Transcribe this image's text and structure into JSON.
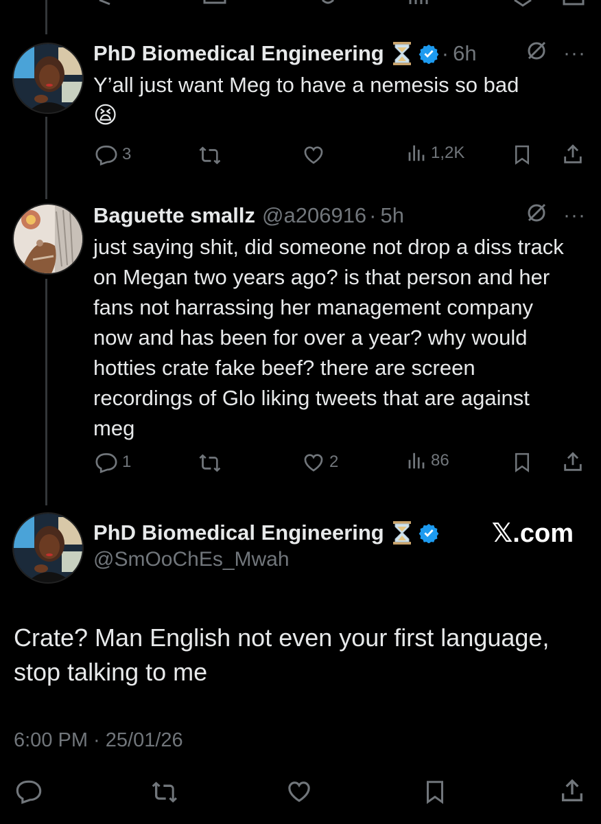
{
  "post1": {
    "name": "PhD Biomedical Engineering",
    "time": "6h",
    "text": "Y’all just want Meg to have a nemesis so bad",
    "emoji": "😫",
    "replies": "3",
    "reposts": "",
    "likes": "",
    "views": "1,2K"
  },
  "post2": {
    "name": "Baguette smallz",
    "handle": "@a206916",
    "time": "5h",
    "text": "just saying shit, did someone not drop a diss track on Megan two years ago? is that person and her fans not harrassing her management company now and has been for over a year? why would hotties crate fake beef? there are screen recordings of Glo liking tweets that are against meg",
    "replies": "1",
    "reposts": "",
    "likes": "2",
    "views": "86"
  },
  "main": {
    "name": "PhD Biomedical Engineering",
    "handle": "@SmOoChEs_Mwah",
    "watermark": "𝕏.com",
    "text": "Crate? Man English not even your first language, stop talking to me",
    "timestamp": "6:00 PM · 25/01/26"
  },
  "colors": {
    "background": "#000000",
    "text": "#e7e9ea",
    "muted": "#71767b",
    "verified": "#1d9bf0"
  },
  "icons": [
    "reply-icon",
    "repost-icon",
    "like-icon",
    "views-icon",
    "bookmark-icon",
    "share-icon",
    "grok-icon",
    "more-icon",
    "verified-badge-icon",
    "hourglass-icon"
  ]
}
